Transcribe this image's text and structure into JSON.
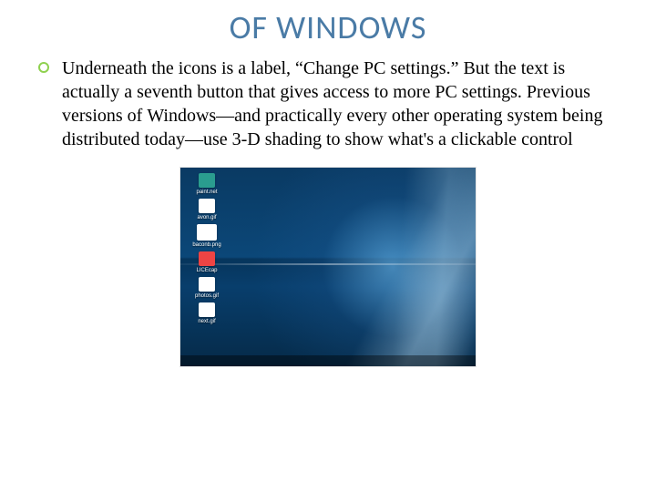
{
  "title": "OF WINDOWS",
  "paragraph": "Underneath the icons is a label, “Change PC settings.” But the text is actually a seventh button that gives access to more PC settings. Previous versions of Windows—and practically every other operating system being distributed today—use 3-D shading to show what's a clickable control",
  "desktop": {
    "icons": [
      {
        "label": "paint.net"
      },
      {
        "label": "avon.gif"
      },
      {
        "label": "baconb.png"
      },
      {
        "label": "LICEcap"
      },
      {
        "label": "photos.gif"
      },
      {
        "label": "next.gif"
      }
    ]
  }
}
